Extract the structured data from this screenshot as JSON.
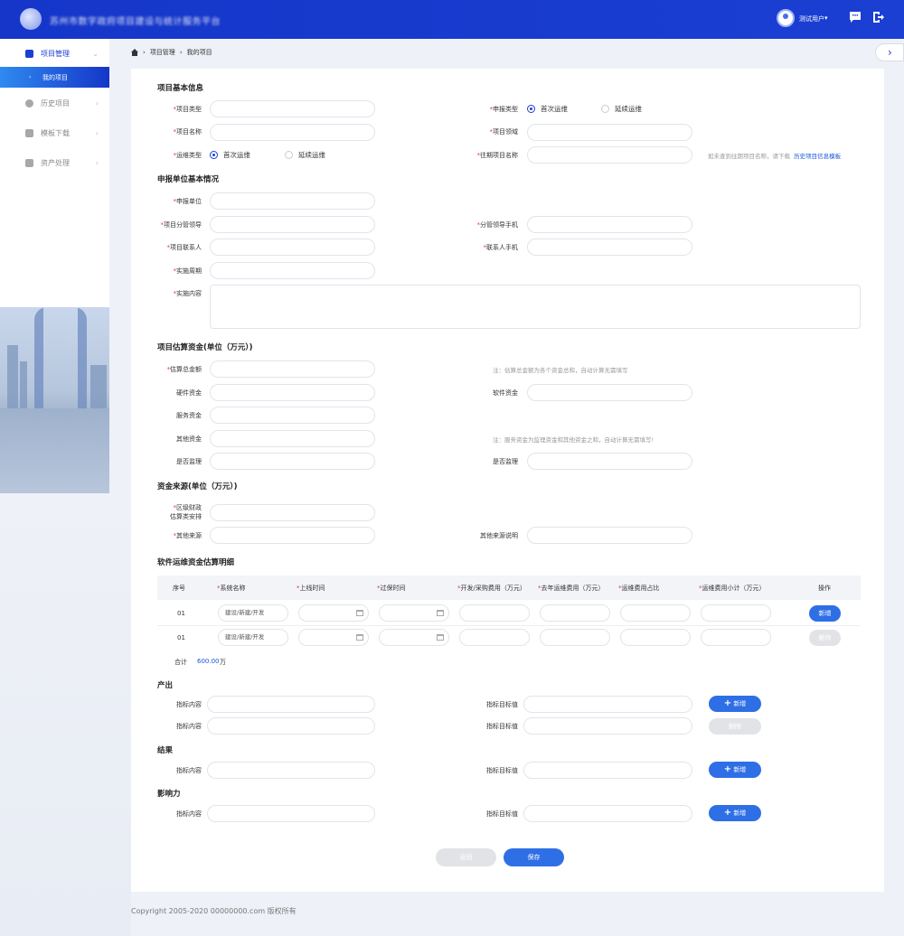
{
  "header": {
    "system_title": "苏州市数字政府项目建设与统计服务平台",
    "user_name": "测试用户",
    "user_caret": "▾",
    "message_icon": "message-icon",
    "logout_icon": "logout-icon"
  },
  "sidebar": {
    "items": [
      {
        "label": "项目管理",
        "icon": "folder-icon",
        "chevron": "⌄"
      },
      {
        "label": "历史项目",
        "icon": "clock-icon",
        "chevron": "›"
      },
      {
        "label": "模板下载",
        "icon": "download-icon",
        "chevron": "›"
      },
      {
        "label": "资产处理",
        "icon": "asset-icon",
        "chevron": "›"
      }
    ],
    "sub_item": {
      "label": "我的项目",
      "marker": "›"
    }
  },
  "breadcrumb": {
    "sep": "›",
    "level1": "项目管理",
    "level2": "我的项目"
  },
  "expand_icon": "›",
  "sections": {
    "basic": "项目基本信息",
    "unit": "申报单位基本情况",
    "budget": "项目估算资金(单位（万元）)",
    "source": "资金来源(单位（万元）)",
    "detail": "软件运维资金估算明细",
    "output": "产出",
    "result": "结果",
    "impact": "影响力"
  },
  "required_mark": "*",
  "basic": {
    "project_type": "项目类型",
    "apply_type": "申报类型",
    "apply_type_options": [
      "首次运维",
      "延续运维"
    ],
    "project_name": "项目名称",
    "project_domain": "项目领域",
    "ops_type": "运维类型",
    "ops_type_options": [
      "首次运维",
      "延续运维"
    ],
    "previous_name": "往期项目名称",
    "previous_hint": "如未查到往期项目名称，请下载",
    "previous_link": "历史项目信息模板"
  },
  "unit": {
    "apply_unit": "申报单位",
    "leader": "项目分管领导",
    "leader_phone": "分管领导手机",
    "contact": "项目联系人",
    "contact_phone": "联系人手机",
    "period": "实施周期",
    "content": "实施内容"
  },
  "budget": {
    "total": "估算总金额",
    "total_note": "注：估算总金额为各个资金总和，自动计算无需填写",
    "hardware": "硬件资金",
    "software": "软件资金",
    "service": "服务资金",
    "other": "其他资金",
    "service_note": "注：服务资金为监理资金和其他资金之和，自动计算无需填写!",
    "supervise_left": "是否监理",
    "supervise_right": "是否监理"
  },
  "source": {
    "district_line1": "区级财政",
    "district_line2": "估算类安排",
    "other_source": "其他来源",
    "other_desc": "其他来源说明"
  },
  "detail_table": {
    "columns": [
      "序号",
      "系统名称",
      "上线时间",
      "过保时间",
      "开发/采购费用（万元）",
      "去年运维费用（万元）",
      "运维费用占比",
      "运维费用小计（万元）",
      "操作"
    ],
    "required_cols": [
      false,
      true,
      true,
      true,
      true,
      true,
      true,
      true,
      false
    ],
    "rows": [
      {
        "no": "01",
        "system_placeholder": "建设/新建/开发",
        "action": "新增"
      },
      {
        "no": "01",
        "system_placeholder": "建设/新建/开发",
        "action": "删除"
      }
    ],
    "total_label": "合计",
    "total_value": "600.00",
    "total_unit": "万"
  },
  "indicators": {
    "content_label": "指标内容",
    "target_label": "指标目标值",
    "add_label": "新增",
    "add_icon": "+",
    "delete_label": "删除"
  },
  "actions": {
    "back": "返回",
    "save": "保存"
  },
  "footer": "Copyright 2005-2020 00000000.com 版权所有"
}
